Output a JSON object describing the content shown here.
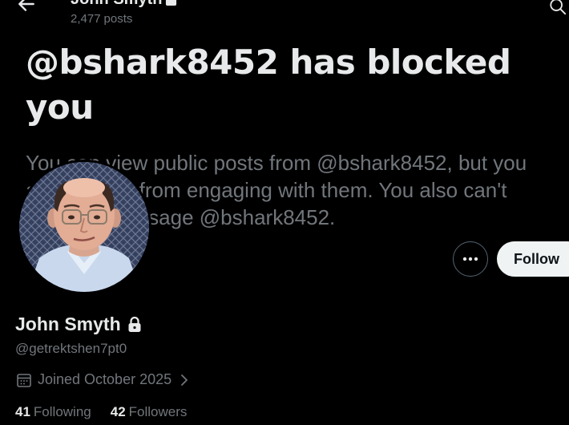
{
  "header": {
    "name": "John Smyth",
    "posts_count": "2,477",
    "posts_label": "posts"
  },
  "blocked": {
    "title": "@bshark8452 has blocked you",
    "body": "You can view public posts from @bshark8452, but you are blocked from engaging with them. You also can't follow or message @bshark8452."
  },
  "actions": {
    "follow_label": "Follow"
  },
  "profile": {
    "name": "John Smyth",
    "handle": "@getrektshen7pt0",
    "joined": "Joined October 2025",
    "following_count": "41",
    "following_label": "Following",
    "followers_count": "42",
    "followers_label": "Followers"
  },
  "icons": {
    "back": "arrow-left-icon",
    "search": "search-icon",
    "lock": "lock-icon",
    "more": "more-horizontal-icon",
    "calendar": "calendar-icon",
    "chevron": "chevron-right-icon"
  },
  "colors": {
    "background": "#000000",
    "primary_text": "#e7e9ea",
    "secondary_text": "#71767b",
    "follow_button_bg": "#eff3f4",
    "follow_button_text": "#0f1419",
    "border": "#536471"
  }
}
